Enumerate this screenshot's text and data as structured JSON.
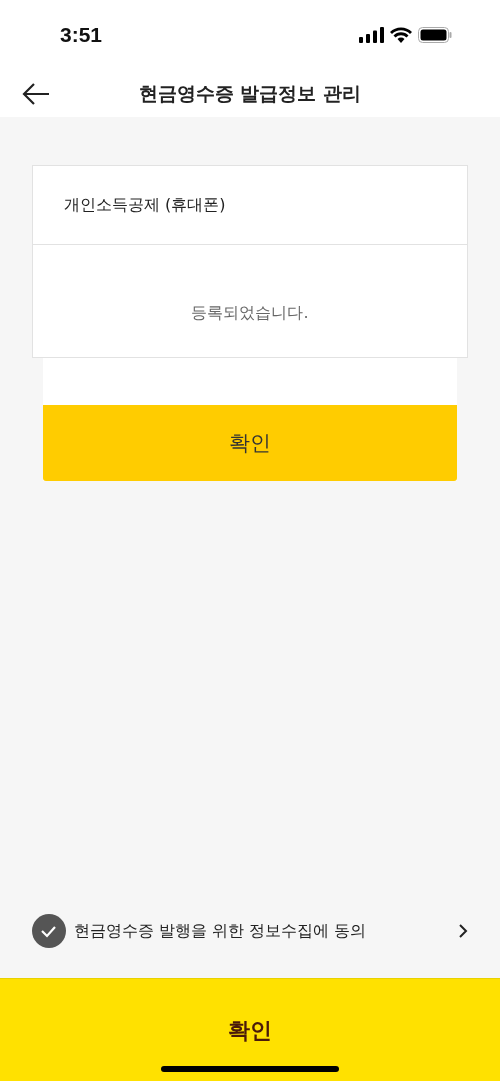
{
  "status_bar": {
    "time": "3:51"
  },
  "header": {
    "title": "현금영수증 발급정보 관리"
  },
  "card": {
    "title": "개인소득공제 (휴대폰)",
    "message": "등록되었습니다."
  },
  "dialog": {
    "button": "확인"
  },
  "agreement": {
    "label": "현금영수증 발행을 위한 정보수집에 동의",
    "checked": true
  },
  "bottom_button": {
    "label": "확인"
  }
}
